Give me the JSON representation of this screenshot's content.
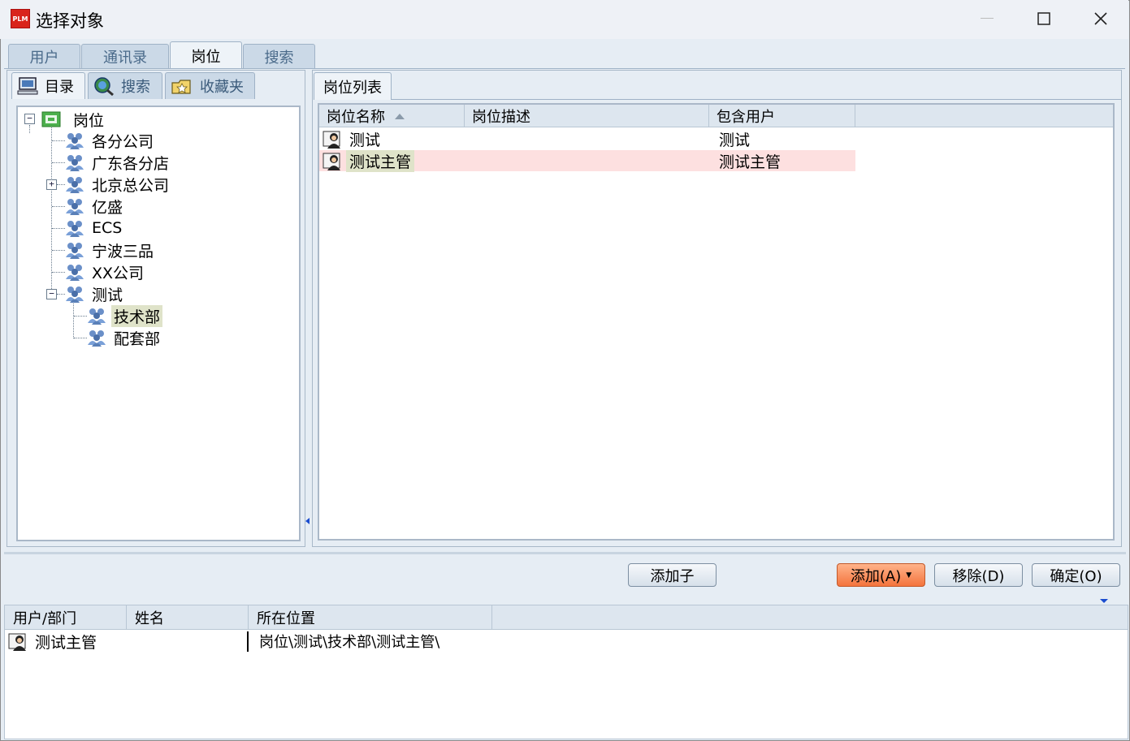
{
  "window": {
    "title": "选择对象",
    "logo_text": "PLM",
    "controls": {
      "minimize": "—",
      "maximize": "☐",
      "close": "✕"
    }
  },
  "top_tabs": [
    {
      "label": "用户",
      "active": false
    },
    {
      "label": "通讯录",
      "active": false
    },
    {
      "label": "岗位",
      "active": true
    },
    {
      "label": "搜索",
      "active": false
    }
  ],
  "left_panel": {
    "sub_tabs": [
      {
        "label": "目录",
        "icon": "computer-icon",
        "active": true
      },
      {
        "label": "搜索",
        "icon": "globe-search-icon",
        "active": false
      },
      {
        "label": "收藏夹",
        "icon": "folder-star-icon",
        "active": false
      }
    ],
    "tree": {
      "root": "岗位",
      "children": [
        {
          "label": "各分公司"
        },
        {
          "label": "广东各分店"
        },
        {
          "label": "北京总公司",
          "expandable": true
        },
        {
          "label": "亿盛"
        },
        {
          "label": "ECS"
        },
        {
          "label": "宁波三品"
        },
        {
          "label": "XX公司"
        },
        {
          "label": "测试",
          "expanded": true,
          "children": [
            {
              "label": "技术部",
              "selected": true
            },
            {
              "label": "配套部"
            }
          ]
        }
      ]
    }
  },
  "right_panel": {
    "tab": "岗位列表",
    "columns": [
      "岗位名称",
      "岗位描述",
      "包含用户"
    ],
    "rows": [
      {
        "name": "测试",
        "desc": "",
        "users": "测试",
        "highlighted": false
      },
      {
        "name": "测试主管",
        "desc": "",
        "users": "测试主管",
        "highlighted": true
      }
    ]
  },
  "buttons": {
    "add_child": "添加子",
    "add": "添加(A)",
    "add_mnemonic": "A",
    "remove": "移除(D)",
    "remove_mnemonic": "D",
    "ok": "确定(O)",
    "ok_mnemonic": "O"
  },
  "selected_table": {
    "columns": [
      "用户/部门",
      "姓名",
      "所在位置"
    ],
    "rows": [
      {
        "user": "测试主管",
        "name": "",
        "location": "岗位\\测试\\技术部\\测试主管\\"
      }
    ]
  },
  "colors": {
    "highlight_row": "#fde0e0",
    "tree_selected": "#dfe3c9",
    "add_button": "#f4743d",
    "accent_blue": "#1a4ccf"
  }
}
